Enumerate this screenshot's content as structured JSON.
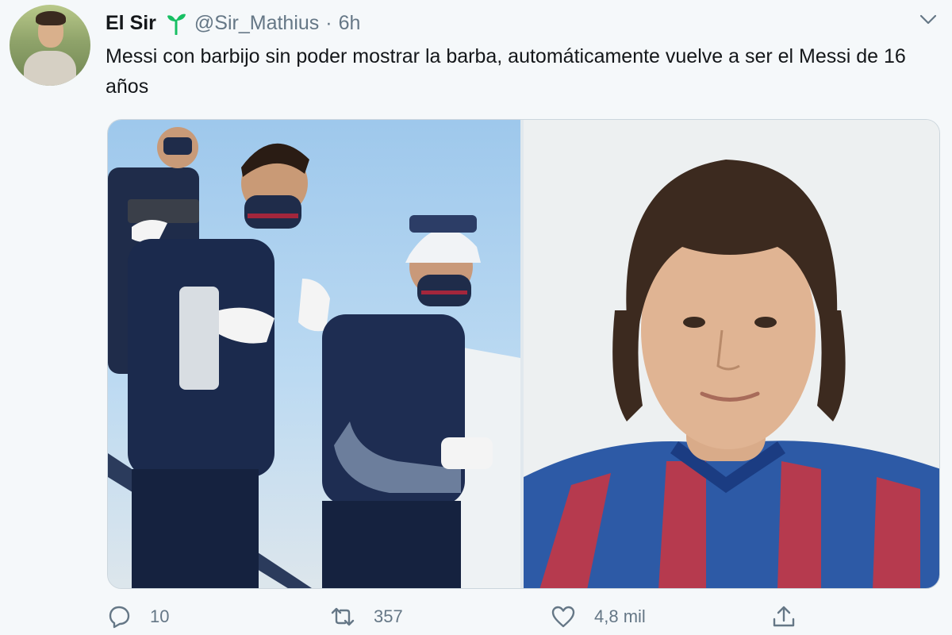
{
  "tweet": {
    "author": {
      "name": "El Sir",
      "badge_icon": "sprout-icon",
      "handle": "@Sir_Mathius",
      "separator": "·",
      "time": "6h"
    },
    "text": "Messi con barbijo sin poder mostrar la barba, automáticamente vuelve a ser el Messi de 16 años",
    "media": {
      "images": [
        {
          "name": "players-descending-plane-photo"
        },
        {
          "name": "young-messi-portrait-photo"
        }
      ]
    },
    "actions": {
      "reply_count": "10",
      "retweet_count": "357",
      "like_count": "4,8 mil"
    }
  },
  "colors": {
    "text": "#14171a",
    "secondary": "#657786",
    "sprout": "#17bf63",
    "background": "#f5f8fa"
  }
}
